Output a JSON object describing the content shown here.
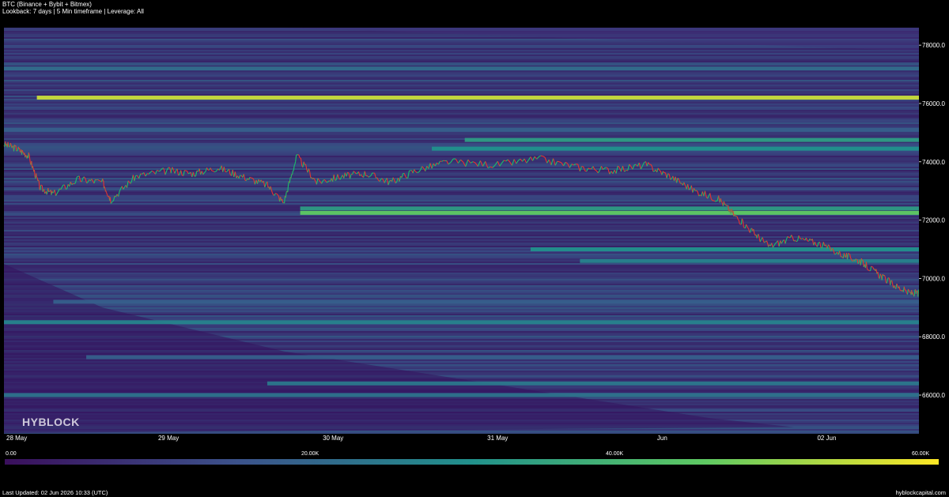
{
  "header": {
    "title": "BTC (Binance + Bybit + Bitmex)",
    "subtitle": "Lookback: 7 days | 5 Min timeframe | Leverage: All"
  },
  "watermark": "HYBLOCK",
  "colorbar": {
    "labels": [
      "0.00",
      "20.00K",
      "40.00K",
      "60.00K"
    ],
    "colors": [
      "#3a0f5c",
      "#3b528b",
      "#21918c",
      "#5ec962",
      "#fde725"
    ]
  },
  "footer": {
    "last_updated": "Last Updated: 02 Jun 2026 10:33 (UTC)",
    "site": "hyblockcapital.com"
  },
  "chart_data": {
    "type": "heatmap",
    "y_ticks": [
      "78000.0",
      "76000.0",
      "74000.0",
      "72000.0",
      "70000.0",
      "68000.0",
      "66000.0"
    ],
    "y_tick_values": [
      78000,
      76000,
      74000,
      72000,
      70000,
      68000,
      66000
    ],
    "ylim": [
      64700,
      78600
    ],
    "x_ticks": [
      "28 May",
      "29 May",
      "30 May",
      "31 May",
      "Jun",
      "02 Jun"
    ],
    "x_tick_days": [
      0,
      1,
      2,
      3,
      4,
      5
    ],
    "xlim_days": [
      0,
      5.56
    ],
    "liquidation_levels": [
      {
        "price": 76200,
        "intensity": 0.92,
        "from_day": 0.2
      },
      {
        "price": 74750,
        "intensity": 0.55,
        "from_day": 2.8
      },
      {
        "price": 74450,
        "intensity": 0.5,
        "from_day": 2.6
      },
      {
        "price": 72250,
        "intensity": 0.75,
        "from_day": 1.8
      },
      {
        "price": 72400,
        "intensity": 0.55,
        "from_day": 1.8
      },
      {
        "price": 71000,
        "intensity": 0.5,
        "from_day": 3.2
      },
      {
        "price": 70600,
        "intensity": 0.45,
        "from_day": 3.5
      },
      {
        "price": 68500,
        "intensity": 0.45,
        "from_day": 0.0
      },
      {
        "price": 66400,
        "intensity": 0.4,
        "from_day": 1.6
      },
      {
        "price": 66000,
        "intensity": 0.38,
        "from_day": 0.0
      },
      {
        "price": 77200,
        "intensity": 0.35,
        "from_day": 0.0
      },
      {
        "price": 75100,
        "intensity": 0.3,
        "from_day": 0.0
      },
      {
        "price": 69200,
        "intensity": 0.3,
        "from_day": 0.3
      },
      {
        "price": 67300,
        "intensity": 0.3,
        "from_day": 0.5
      }
    ],
    "price_path": [
      [
        0.0,
        74600
      ],
      [
        0.08,
        74450
      ],
      [
        0.15,
        74200
      ],
      [
        0.22,
        73100
      ],
      [
        0.3,
        72900
      ],
      [
        0.45,
        73400
      ],
      [
        0.6,
        73300
      ],
      [
        0.65,
        72700
      ],
      [
        0.8,
        73500
      ],
      [
        1.0,
        73700
      ],
      [
        1.15,
        73600
      ],
      [
        1.3,
        73800
      ],
      [
        1.45,
        73500
      ],
      [
        1.6,
        73200
      ],
      [
        1.7,
        72600
      ],
      [
        1.78,
        74200
      ],
      [
        1.9,
        73300
      ],
      [
        2.05,
        73500
      ],
      [
        2.2,
        73600
      ],
      [
        2.35,
        73300
      ],
      [
        2.5,
        73700
      ],
      [
        2.7,
        74000
      ],
      [
        3.0,
        73900
      ],
      [
        3.25,
        74100
      ],
      [
        3.5,
        73800
      ],
      [
        3.7,
        73700
      ],
      [
        3.9,
        73900
      ],
      [
        4.05,
        73500
      ],
      [
        4.2,
        73000
      ],
      [
        4.35,
        72700
      ],
      [
        4.45,
        72100
      ],
      [
        4.55,
        71600
      ],
      [
        4.65,
        71100
      ],
      [
        4.8,
        71400
      ],
      [
        4.95,
        71200
      ],
      [
        5.1,
        70800
      ],
      [
        5.2,
        70600
      ],
      [
        5.3,
        70200
      ],
      [
        5.4,
        69800
      ],
      [
        5.5,
        69500
      ],
      [
        5.56,
        69500
      ]
    ]
  }
}
